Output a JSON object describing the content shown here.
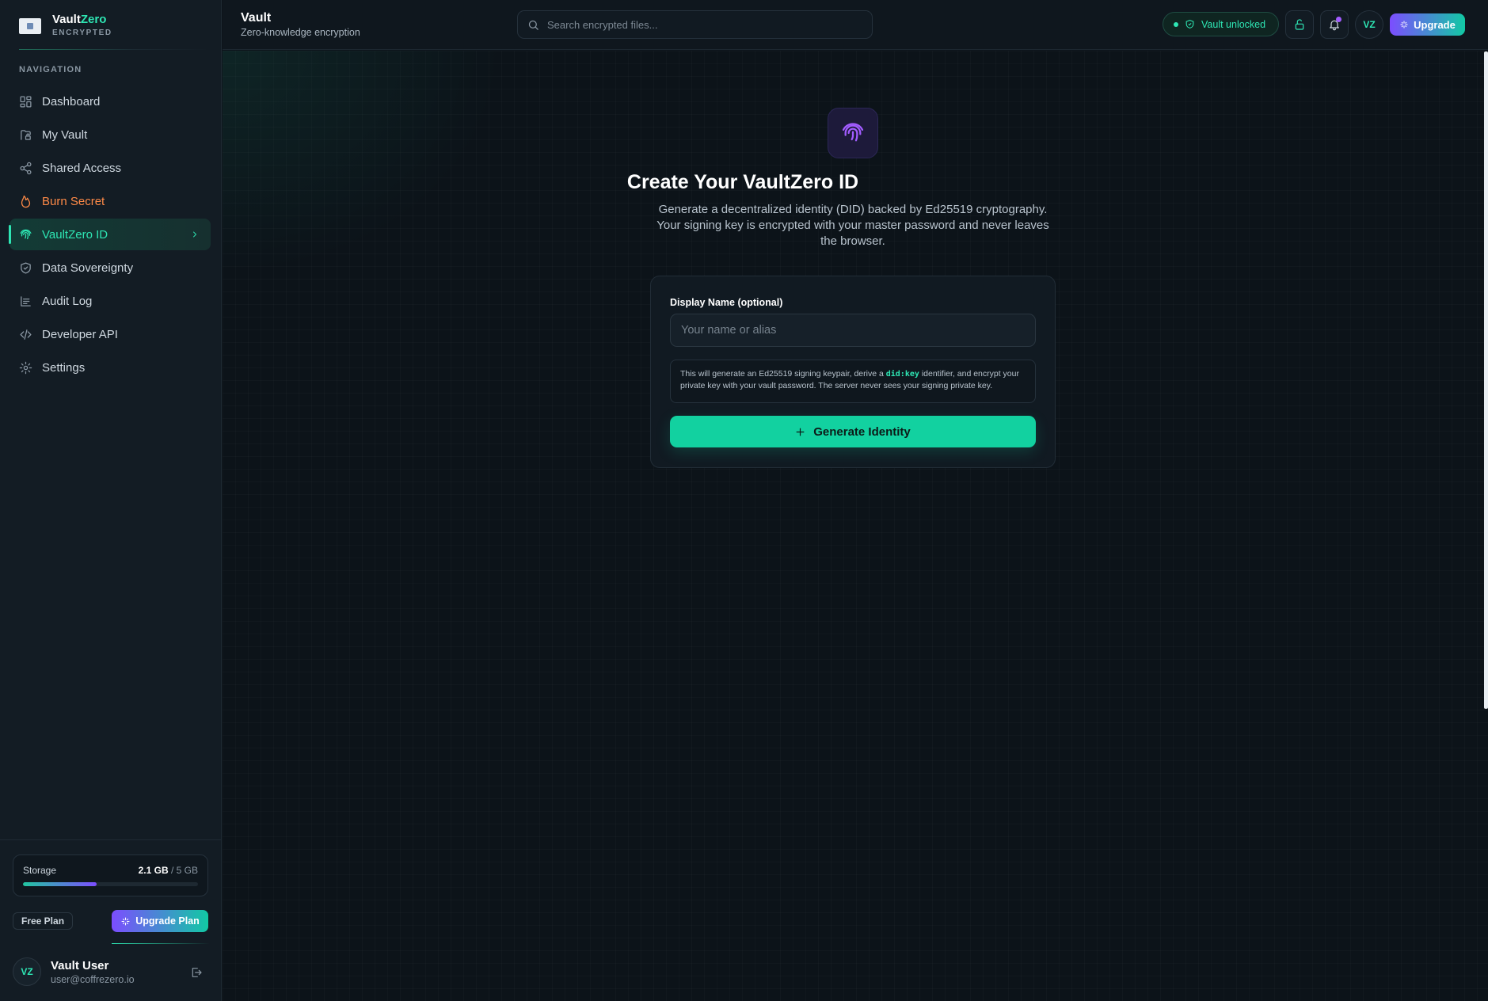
{
  "brand": {
    "name_main": "Vault",
    "name_accent": "Zero",
    "subtitle": "ENCRYPTED"
  },
  "sidebar": {
    "heading": "NAVIGATION",
    "items": [
      {
        "label": "Dashboard",
        "icon": "dashboard-icon"
      },
      {
        "label": "My Vault",
        "icon": "vault-icon"
      },
      {
        "label": "Shared Access",
        "icon": "share-icon"
      },
      {
        "label": "Burn Secret",
        "icon": "flame-icon",
        "color": "#ff8a47"
      },
      {
        "label": "VaultZero ID",
        "icon": "fingerprint-icon",
        "active": true
      },
      {
        "label": "Data Sovereignty",
        "icon": "shield-icon"
      },
      {
        "label": "Audit Log",
        "icon": "log-icon"
      },
      {
        "label": "Developer API",
        "icon": "code-icon"
      },
      {
        "label": "Settings",
        "icon": "gear-icon"
      }
    ],
    "storage": {
      "label": "Storage",
      "used": "2.1 GB",
      "separator": " / ",
      "total": "5 GB",
      "fraction": 0.42
    },
    "plan": {
      "badge": "Free Plan",
      "upgrade_label": "Upgrade Plan"
    },
    "user": {
      "initials": "VZ",
      "name": "Vault User",
      "email": "user@coffrezero.io"
    }
  },
  "header": {
    "title": "Vault",
    "subtitle": "Zero-knowledge encryption",
    "search_placeholder": "Search encrypted files...",
    "status": "Vault unlocked",
    "avatar_initials": "VZ",
    "upgrade_label": "Upgrade"
  },
  "main": {
    "title": "Create Your VaultZero ID",
    "description": "Generate a decentralized identity (DID) backed by Ed25519 cryptography. Your signing key is encrypted with your master password and never leaves the browser.",
    "field_label": "Display Name (optional)",
    "field_placeholder": "Your name or alias",
    "field_value": "",
    "info_before": "This will generate an Ed25519 signing keypair, derive a ",
    "info_code": "did:key",
    "info_after": " identifier, and encrypt your private key with your vault password. The server never sees your signing private key.",
    "button_label": "Generate Identity"
  },
  "colors": {
    "accent": "#2ee6b4",
    "purple": "#7c4dff",
    "burn": "#ff8a47",
    "background": "#0d141b"
  }
}
